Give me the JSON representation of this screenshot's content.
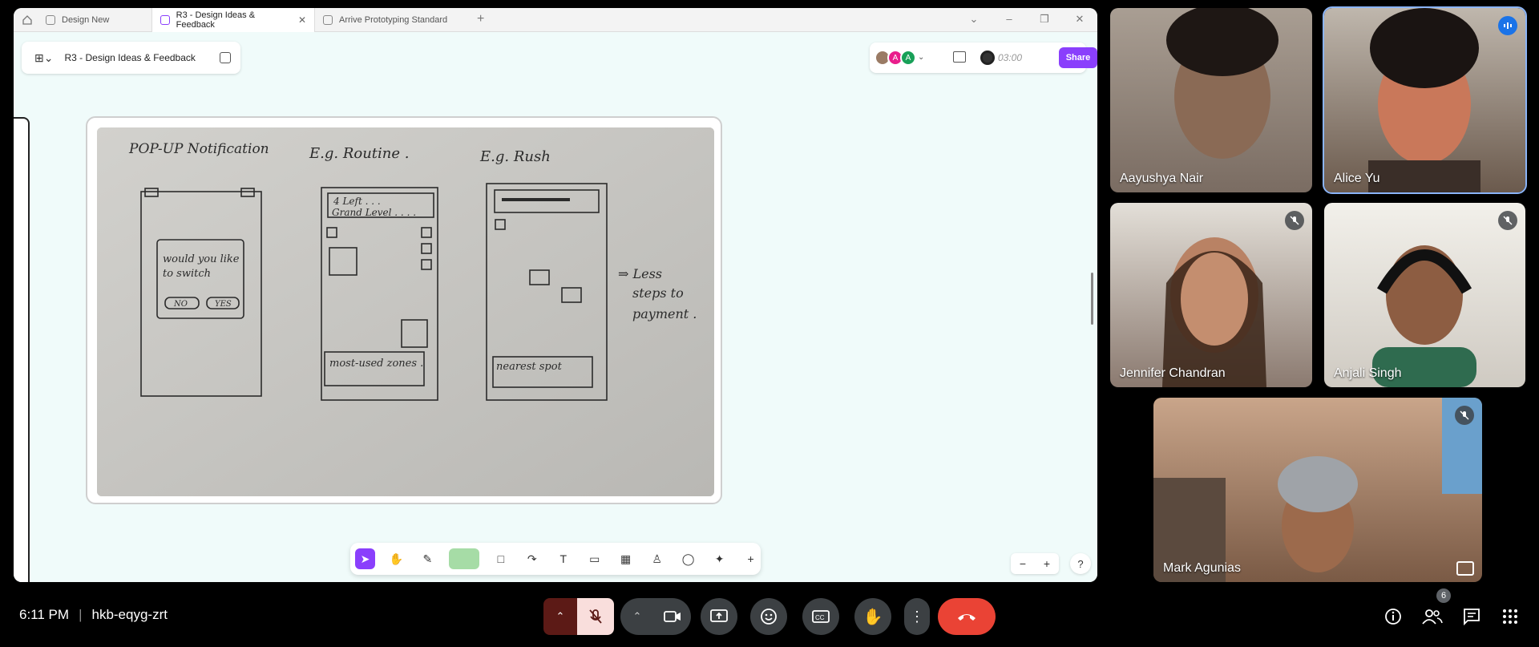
{
  "browser": {
    "tabs": [
      {
        "label": "Design New"
      },
      {
        "label": "R3 - Design Ideas & Feedback"
      },
      {
        "label": "Arrive Prototyping Standard"
      }
    ]
  },
  "figma": {
    "file_name": "R3 - Design Ideas & Feedback",
    "collaborators": [
      "A",
      "A"
    ],
    "timer": "03:00",
    "share_label": "Share",
    "help_label": "?"
  },
  "sketch": {
    "titles": [
      "POP-UP Notification",
      "E.g. Routine .",
      "E.g. Rush"
    ],
    "popup_text": [
      "would you like",
      "to switch"
    ],
    "popup_buttons": [
      "NO",
      "YES"
    ],
    "routine_banner": [
      "4 Left . . .",
      "Grand Level . . . ."
    ],
    "routine_footer": "most-used zones .",
    "rush_footer": "nearest spot",
    "note": [
      "⇒ Less",
      "steps to",
      "payment ."
    ]
  },
  "meet": {
    "time": "6:11 PM",
    "meeting_code": "hkb-eqyg-zrt",
    "participant_count": "6",
    "participants": [
      {
        "name": "Aayushya Nair"
      },
      {
        "name": "Alice Yu"
      },
      {
        "name": "Jennifer Chandran"
      },
      {
        "name": "Anjali Singh"
      },
      {
        "name": "Mark Agunias"
      }
    ],
    "colors": {
      "end_call": "#ea4335",
      "mic_off": "#f9dedc",
      "accent": "#8a3ffc"
    }
  }
}
